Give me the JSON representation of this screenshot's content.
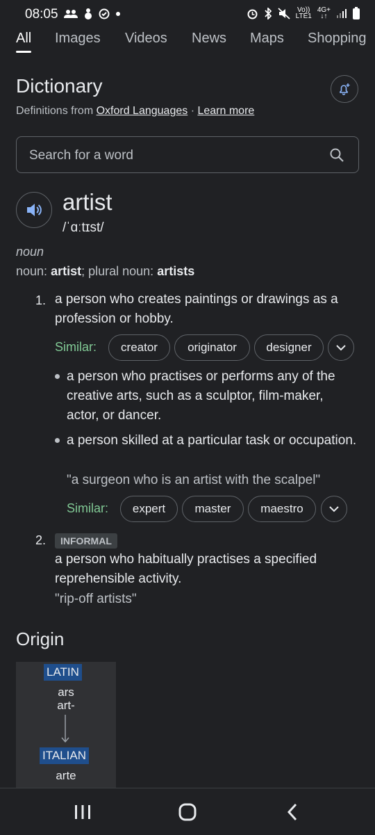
{
  "status_bar": {
    "time": "08:05",
    "network_top": "Vo))",
    "network_bottom": "LTE1",
    "data_type": "4G+"
  },
  "tabs": [
    "All",
    "Images",
    "Videos",
    "News",
    "Maps",
    "Shopping"
  ],
  "dictionary": {
    "title": "Dictionary",
    "source_prefix": "Definitions from ",
    "source_link": "Oxford Languages",
    "separator": " · ",
    "learn_more": "Learn more"
  },
  "search": {
    "placeholder": "Search for a word"
  },
  "entry": {
    "word": "artist",
    "phonetic": "/ˈɑːtɪst/",
    "part_of_speech": "noun",
    "forms_prefix": "noun",
    "forms_word": "artist",
    "forms_plural_label": "plural noun",
    "forms_plural": "artists"
  },
  "senses": [
    {
      "number": "1.",
      "definition": "a person who creates paintings or drawings as a profession or hobby.",
      "similar_label": "Similar:",
      "similar": [
        "creator",
        "originator",
        "designer"
      ]
    },
    {
      "definition": "a person who practises or performs any of the creative arts, such as a sculptor, film-maker, actor, or dancer."
    },
    {
      "definition": "a person skilled at a particular task or occupation.",
      "example": "\"a surgeon who is an artist with the scalpel\"",
      "similar_label": "Similar:",
      "similar": [
        "expert",
        "master",
        "maestro"
      ]
    },
    {
      "number": "2.",
      "label": "INFORMAL",
      "definition": "a person who habitually practises a specified reprehensible activity.",
      "example": "\"rip-off artists\""
    }
  ],
  "origin": {
    "title": "Origin",
    "steps": [
      {
        "language": "LATIN",
        "words": "ars\nart-"
      },
      {
        "language": "ITALIAN",
        "words": "arte"
      }
    ]
  },
  "colors": {
    "background": "#202124",
    "text": "#e8eaed",
    "secondary_text": "#bdc1c6",
    "similar_green": "#81c995",
    "border": "#5f6368",
    "accent_blue": "#8ab4f8",
    "etymology_language_bg": "#1f4e8c"
  },
  "nav_icons": [
    "recent-apps-icon",
    "home-icon",
    "back-icon"
  ]
}
